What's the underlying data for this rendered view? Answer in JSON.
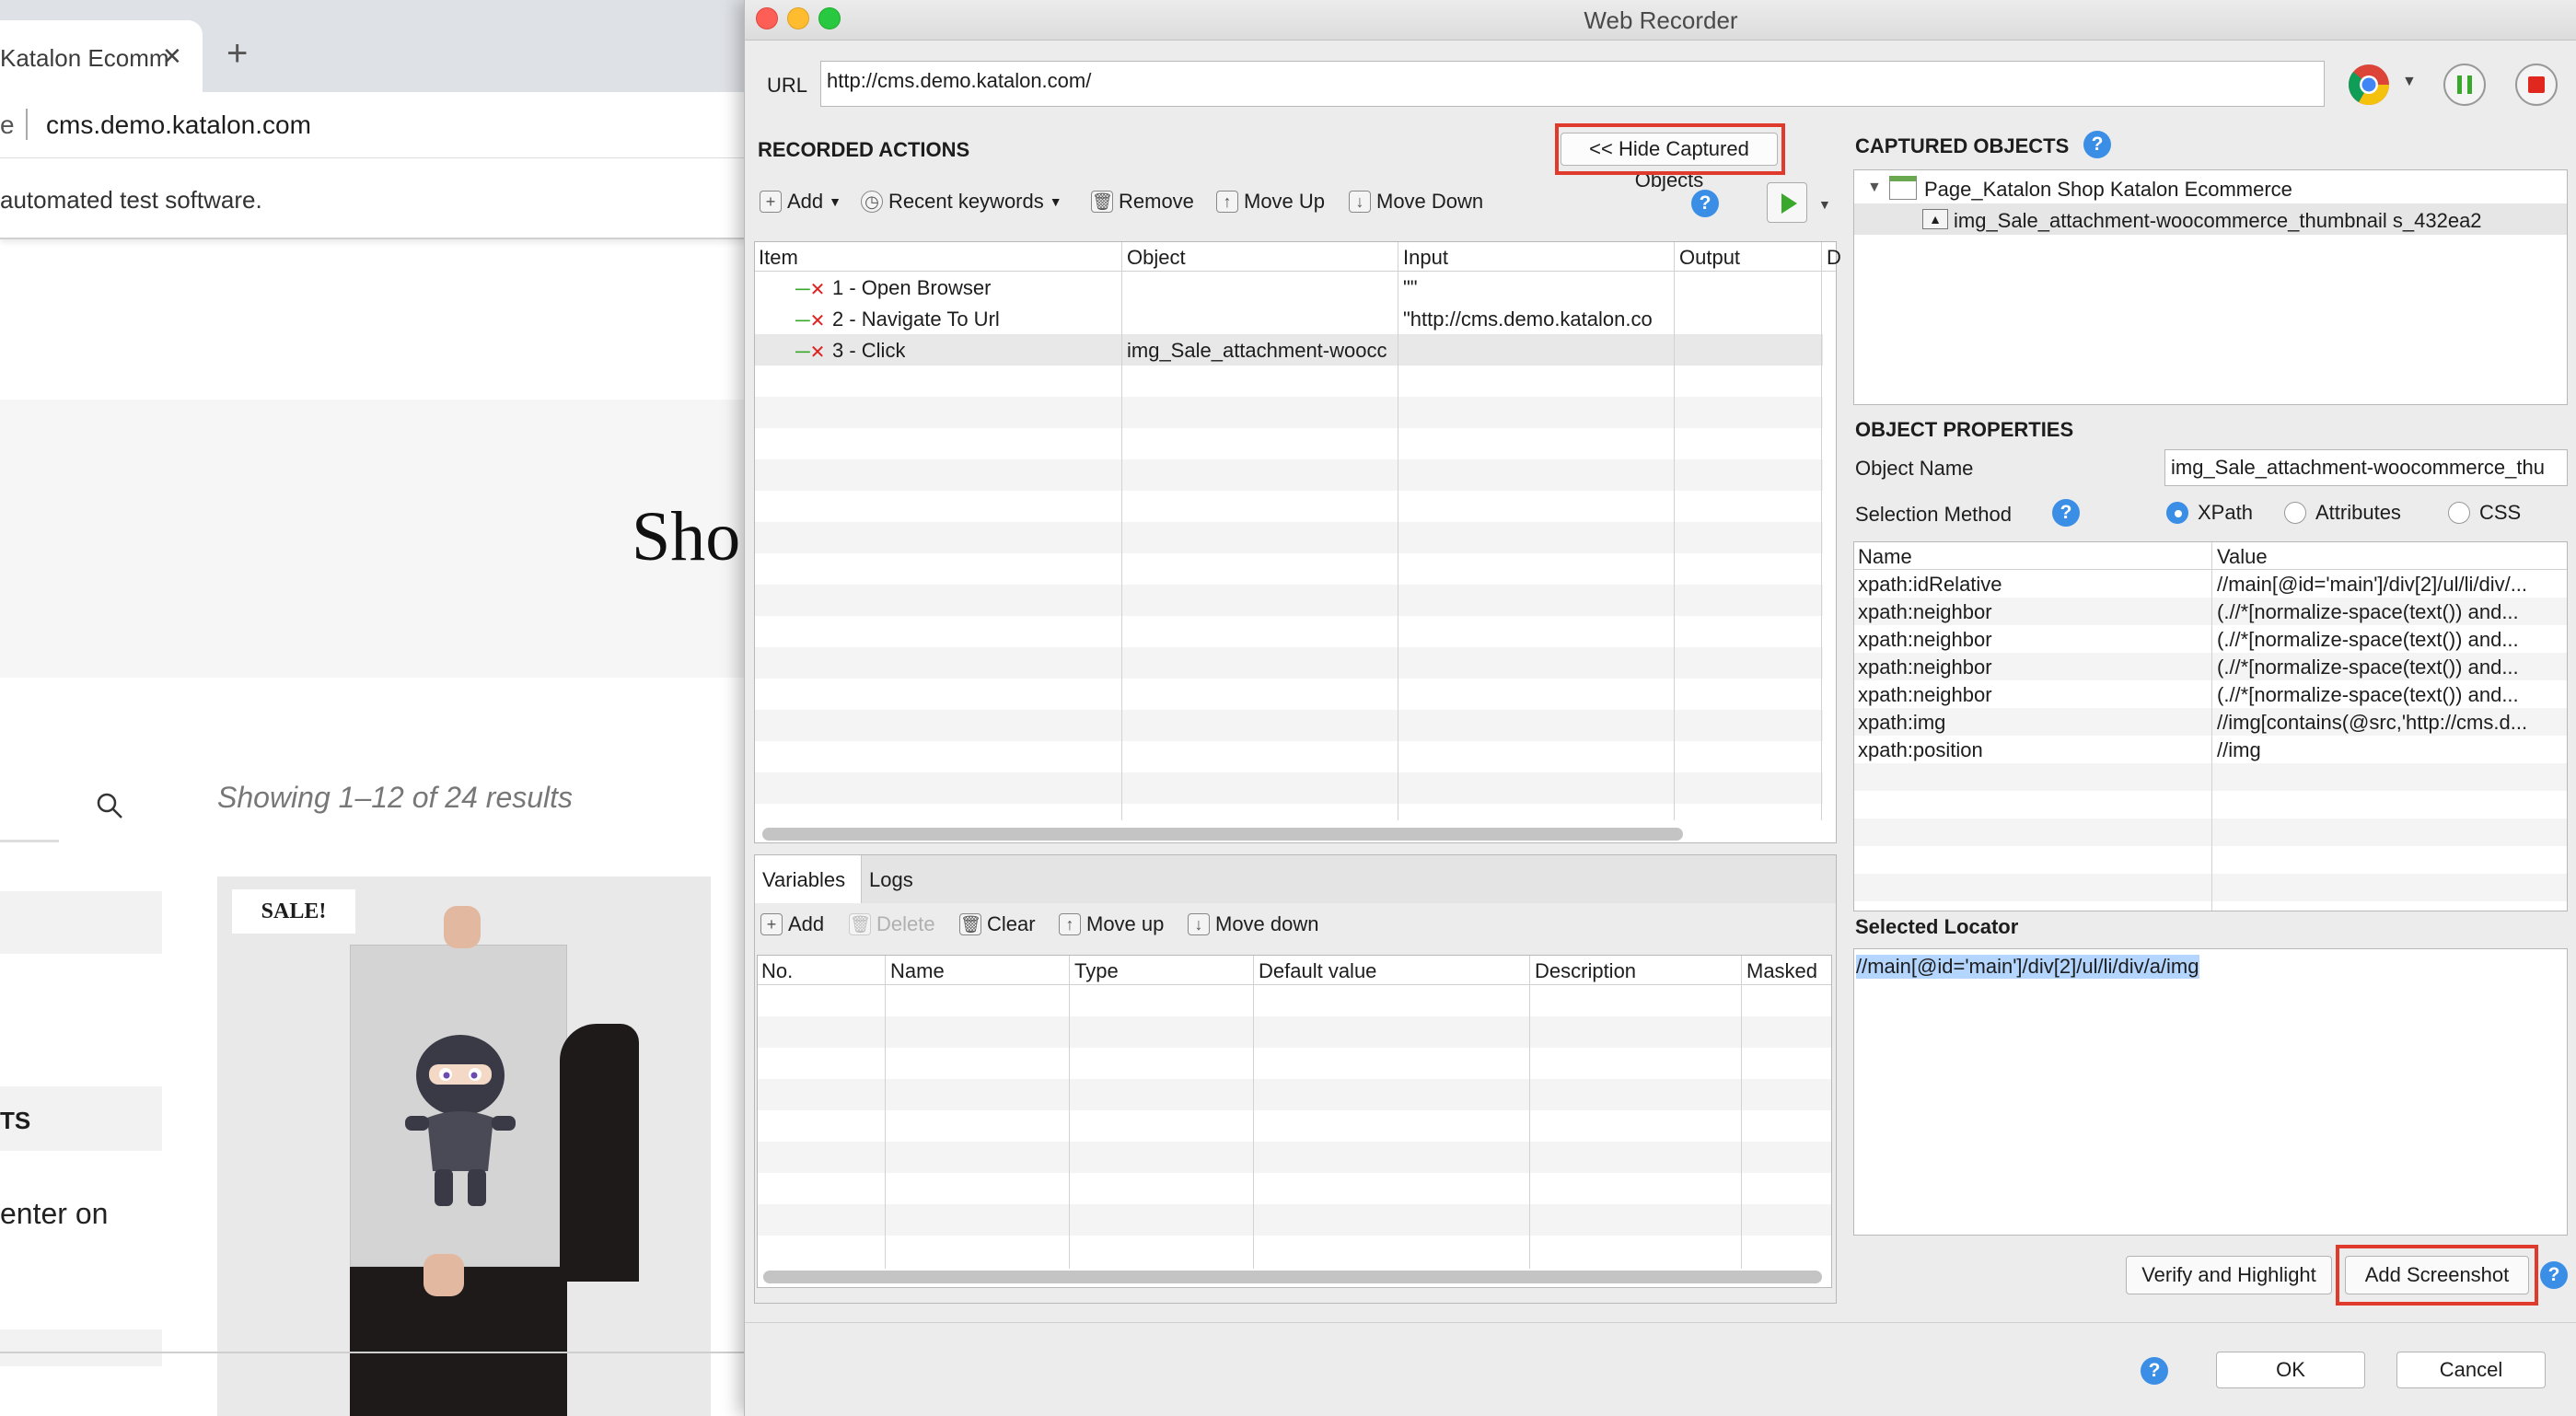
{
  "browser": {
    "tab_title": "Katalon Ecomm",
    "tab_close": "✕",
    "new_tab": "+",
    "address_prefix": "e",
    "address": "cms.demo.katalon.com",
    "info_text": "automated test software.",
    "hero_title": "Sho",
    "results_text": "Showing 1–12 of 24 results",
    "sidebar_heading": "TS",
    "sidebar_text": "enter on",
    "sale_badge": "SALE!"
  },
  "recorder": {
    "window_title": "Web Recorder",
    "url_label": "URL",
    "url_value": "http://cms.demo.katalon.com/",
    "recorded_actions": {
      "title": "RECORDED ACTIONS",
      "hide_captured_label": "<< Hide Captured Objects",
      "toolbar": {
        "add": "Add",
        "recent_keywords": "Recent keywords",
        "remove": "Remove",
        "move_up": "Move Up",
        "move_down": "Move Down"
      },
      "columns": [
        "Item",
        "Object",
        "Input",
        "Output",
        "D"
      ],
      "rows": [
        {
          "item": "1 - Open Browser",
          "object": "",
          "input": "\"\"",
          "output": ""
        },
        {
          "item": "2 - Navigate To Url",
          "object": "",
          "input": "\"http://cms.demo.katalon.co",
          "output": ""
        },
        {
          "item": "3 - Click",
          "object": "img_Sale_attachment-woocc",
          "input": "",
          "output": ""
        }
      ]
    },
    "variables": {
      "tabs": [
        "Variables",
        "Logs"
      ],
      "toolbar": {
        "add": "Add",
        "delete": "Delete",
        "clear": "Clear",
        "move_up": "Move up",
        "move_down": "Move down"
      },
      "columns": [
        "No.",
        "Name",
        "Type",
        "Default value",
        "Description",
        "Masked"
      ]
    },
    "captured_objects": {
      "title": "CAPTURED OBJECTS",
      "page_node": "Page_Katalon Shop  Katalon Ecommerce",
      "child_node": "img_Sale_attachment-woocommerce_thumbnail s_432ea2"
    },
    "object_properties": {
      "title": "OBJECT PROPERTIES",
      "object_name_label": "Object Name",
      "object_name_value": "img_Sale_attachment-woocommerce_thu",
      "selection_method_label": "Selection Method",
      "methods": [
        "XPath",
        "Attributes",
        "CSS"
      ],
      "selected_method": "XPath",
      "columns": [
        "Name",
        "Value"
      ],
      "rows": [
        {
          "name": "xpath:idRelative",
          "value": "//main[@id='main']/div[2]/ul/li/div/..."
        },
        {
          "name": "xpath:neighbor",
          "value": "(.//*[normalize-space(text()) and..."
        },
        {
          "name": "xpath:neighbor",
          "value": "(.//*[normalize-space(text()) and..."
        },
        {
          "name": "xpath:neighbor",
          "value": "(.//*[normalize-space(text()) and..."
        },
        {
          "name": "xpath:neighbor",
          "value": "(.//*[normalize-space(text()) and..."
        },
        {
          "name": "xpath:img",
          "value": "//img[contains(@src,'http://cms.d..."
        },
        {
          "name": "xpath:position",
          "value": "//img"
        }
      ]
    },
    "selected_locator": {
      "title": "Selected Locator",
      "value": "//main[@id='main']/div[2]/ul/li/div/a/img"
    },
    "buttons": {
      "verify": "Verify and Highlight",
      "add_screenshot": "Add Screenshot",
      "ok": "OK",
      "cancel": "Cancel"
    },
    "help_glyph": "?",
    "colors": {
      "highlight_box": "#e03a2c",
      "help": "#3a8ee6",
      "record_stop": "#e0281e",
      "pause": "#3aa82a"
    }
  }
}
